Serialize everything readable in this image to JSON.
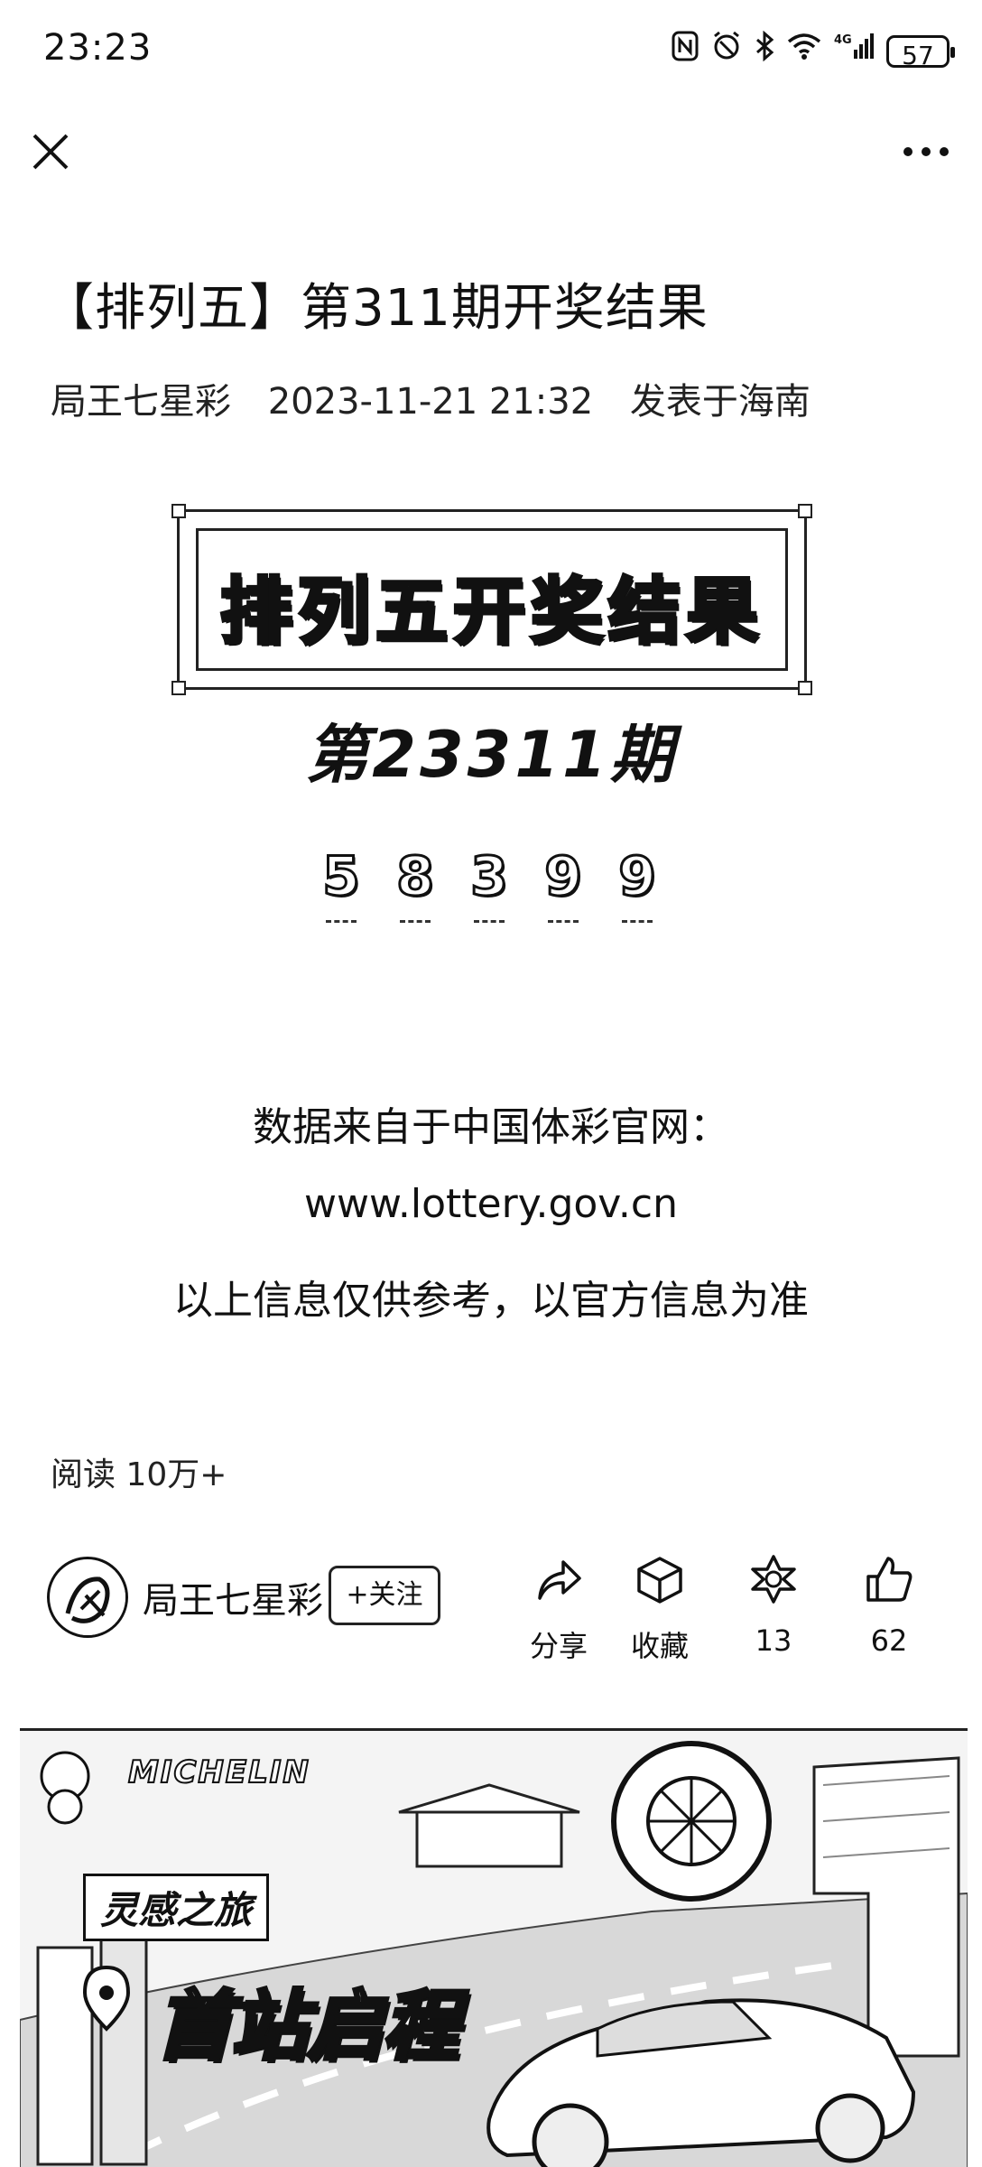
{
  "status_bar": {
    "time": "23:23",
    "battery": "57",
    "network": "4G",
    "icons": [
      "nfc-icon",
      "alarm-icon",
      "bluetooth-icon",
      "wifi-icon",
      "signal-icon",
      "battery-icon"
    ]
  },
  "nav": {
    "close_icon": "close-icon",
    "more_icon": "more-icon"
  },
  "article": {
    "title": "【排列五】第311期开奖结果",
    "author": "局王七星彩",
    "date": "2023-11-21 21:32",
    "location": "发表于海南"
  },
  "content": {
    "banner_text": "排列五开奖结果",
    "issue": "第23311期",
    "numbers": [
      "5",
      "8",
      "3",
      "9",
      "9"
    ],
    "source_line": "数据来自于中国体彩官网：",
    "url": "www.lottery.gov.cn",
    "disclaimer": "以上信息仅供参考，以官方信息为准"
  },
  "stats": {
    "read_label": "阅读 10万+"
  },
  "author_bar": {
    "name": "局王七星彩",
    "follow_label": "+关注",
    "share_label": "分享",
    "favorite_label": "收藏",
    "wow_count": "13",
    "like_count": "62"
  },
  "ad": {
    "brand": "MICHELIN",
    "slogan_1": "灵感之旅",
    "slogan_2": "首站启程"
  }
}
